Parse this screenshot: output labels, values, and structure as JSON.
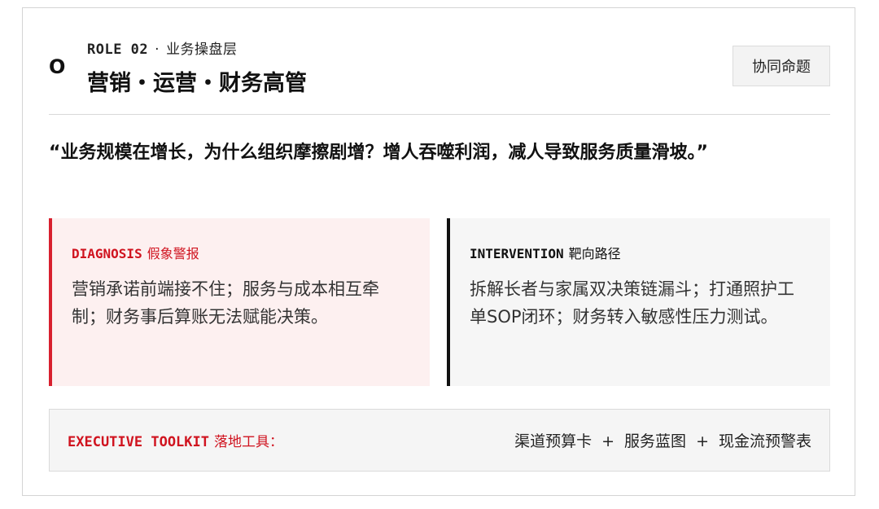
{
  "header": {
    "role_code": "ROLE 02",
    "role_separator": "·",
    "role_subtitle": "业务操盘层",
    "role_icon": "ring-icon",
    "title": "营销・运营・财务高管",
    "tag_button": "协同命题"
  },
  "quote": "“业务规模在增长，为什么组织摩擦剧增？增人吞噬利润，减人导致服务质量滑坡。”",
  "diagnosis": {
    "code": "DIAGNOSIS",
    "label": "假象警报",
    "body": "营销承诺前端接不住；服务与成本相互牵制；财务事后算账无法赋能决策。"
  },
  "intervention": {
    "code": "INTERVENTION",
    "label": "靶向路径",
    "body": "拆解长者与家属双决策链漏斗；打通照护工单SOP闭环；财务转入敏感性压力测试。"
  },
  "toolkit": {
    "code": "EXECUTIVE TOOLKIT",
    "label": "落地工具：",
    "items": [
      "渠道预算卡",
      "服务蓝图",
      "现金流预警表"
    ],
    "joiner": "+"
  },
  "colors": {
    "accent_red": "#d0131f",
    "diagnosis_bg": "#fdf0f0",
    "intervention_bg": "#f6f6f6",
    "text_dark": "#111111"
  }
}
